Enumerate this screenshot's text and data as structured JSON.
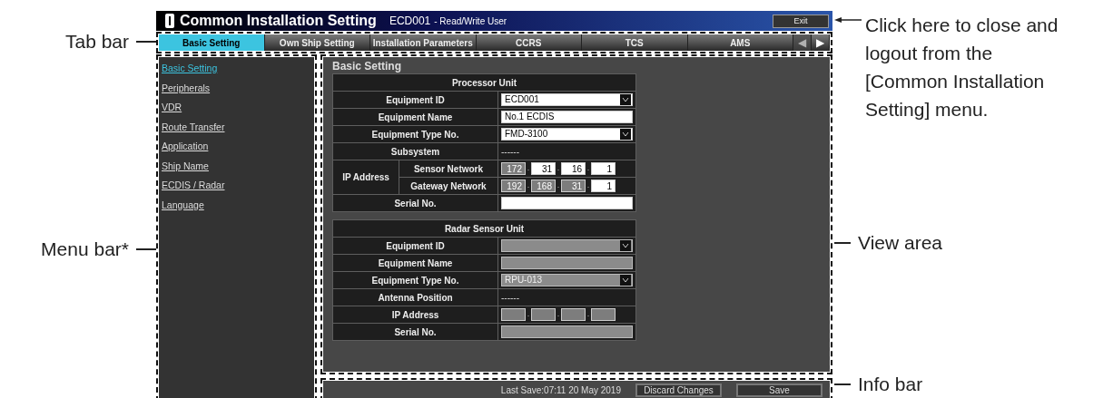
{
  "window": {
    "title": "Common Installation Setting",
    "equipment": "ECD001",
    "user": "- Read/Write User",
    "exit_button": "Exit"
  },
  "tabs": [
    {
      "label": "Basic Setting",
      "selected": true
    },
    {
      "label": "Own Ship Setting",
      "selected": false
    },
    {
      "label": "Installation Parameters",
      "selected": false
    },
    {
      "label": "CCRS",
      "selected": false
    },
    {
      "label": "TCS",
      "selected": false
    },
    {
      "label": "AMS",
      "selected": false
    }
  ],
  "tab_arrows": [
    {
      "symbol": "◀",
      "disabled": true
    },
    {
      "symbol": "▶",
      "disabled": false
    }
  ],
  "menu": [
    {
      "label": "Basic Setting",
      "selected": true
    },
    {
      "label": "Peripherals",
      "selected": false
    },
    {
      "label": "VDR",
      "selected": false
    },
    {
      "label": "Route Transfer",
      "selected": false
    },
    {
      "label": "Application",
      "selected": false
    },
    {
      "label": "Ship Name",
      "selected": false
    },
    {
      "label": "ECDIS / Radar",
      "selected": false
    },
    {
      "label": "Language",
      "selected": false
    }
  ],
  "view": {
    "title": "Basic Setting",
    "sections": [
      {
        "title": "Processor Unit",
        "rows": [
          {
            "kind": "dropdown",
            "label": "Equipment ID",
            "value": "ECD001",
            "disabled": false
          },
          {
            "kind": "text",
            "label": "Equipment Name",
            "value": "No.1 ECDIS",
            "disabled": false
          },
          {
            "kind": "dropdown",
            "label": "Equipment Type No.",
            "value": "FMD-3100",
            "disabled": false
          },
          {
            "kind": "static",
            "label": "Subsystem",
            "value": "------"
          },
          {
            "kind": "ip_group",
            "label": "IP Address",
            "subrows": [
              {
                "label": "Sensor Network",
                "separator": ".",
                "octets": [
                  {
                    "value": "172",
                    "disabled": true
                  },
                  {
                    "value": "31",
                    "disabled": false
                  },
                  {
                    "value": "16",
                    "disabled": false
                  },
                  {
                    "value": "1",
                    "disabled": false
                  }
                ]
              },
              {
                "label": "Gateway Network",
                "separator": ".",
                "octets": [
                  {
                    "value": "192",
                    "disabled": true
                  },
                  {
                    "value": "168",
                    "disabled": true
                  },
                  {
                    "value": "31",
                    "disabled": true
                  },
                  {
                    "value": "1",
                    "disabled": false
                  }
                ]
              }
            ]
          },
          {
            "kind": "text",
            "label": "Serial No.",
            "disabled": false
          }
        ]
      },
      {
        "title": "Radar Sensor Unit",
        "rows": [
          {
            "kind": "dropdown",
            "label": "Equipment ID",
            "disabled": true
          },
          {
            "kind": "text",
            "label": "Equipment Name",
            "disabled": true
          },
          {
            "kind": "dropdown",
            "label": "Equipment Type No.",
            "value": "RPU-013",
            "disabled": true
          },
          {
            "kind": "static",
            "label": "Antenna Position",
            "value": "------"
          },
          {
            "kind": "ip",
            "label": "IP Address",
            "separator": ".",
            "octets": [
              {
                "disabled": true
              },
              {
                "disabled": true
              },
              {
                "disabled": true
              },
              {
                "disabled": true
              }
            ]
          },
          {
            "kind": "text",
            "label": "Serial No.",
            "disabled": true
          }
        ]
      }
    ]
  },
  "info_bar": {
    "last_save": "Last Save:07:11 20 May 2019",
    "buttons": [
      "Discard Changes",
      "Save"
    ]
  },
  "callouts": {
    "tab_bar": "Tab bar",
    "menu_bar": "Menu bar*",
    "exit_lines": [
      "Click here to close and",
      "logout from the",
      "[Common Installation",
      "Setting] menu."
    ],
    "view_area": "View area",
    "info_bar": "Info bar"
  }
}
